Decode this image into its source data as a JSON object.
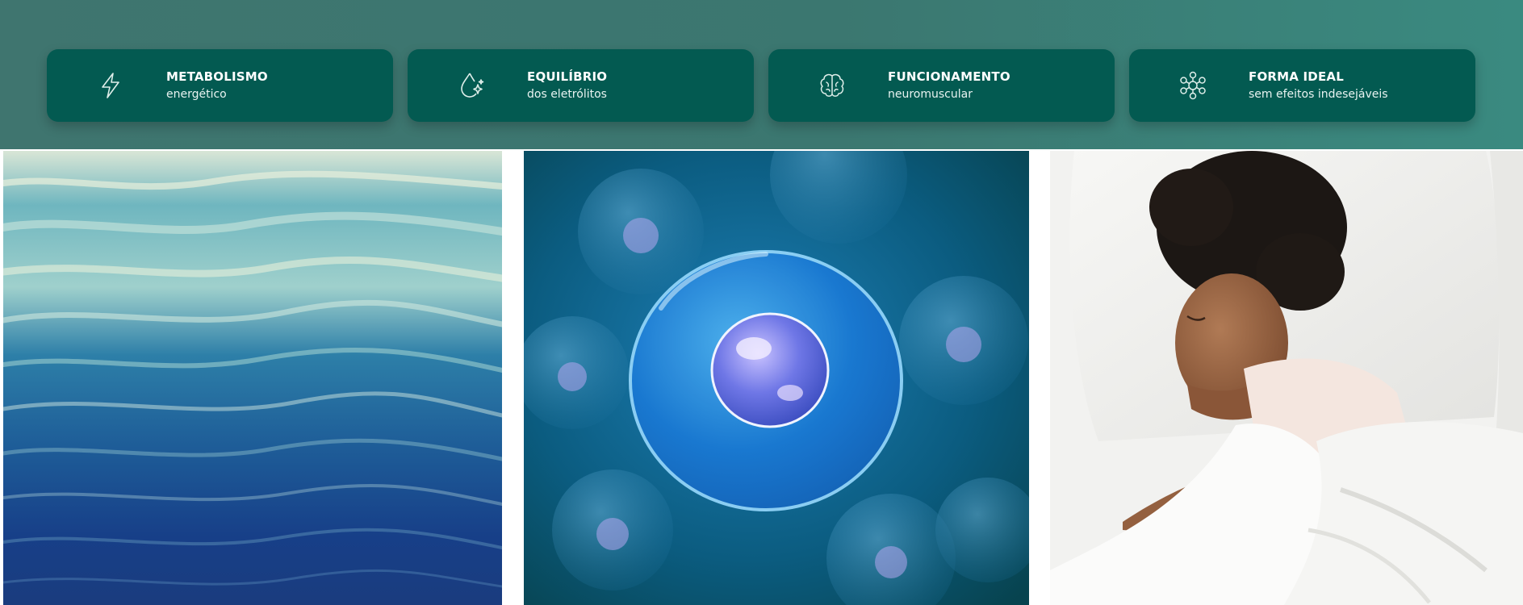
{
  "benefits": [
    {
      "title": "METABOLISMO",
      "subtitle": "energético",
      "icon": "lightning-bolt-icon"
    },
    {
      "title": "EQUILÍBRIO",
      "subtitle": "dos eletrólitos",
      "icon": "water-drop-sparkle-icon"
    },
    {
      "title": "FUNCIONAMENTO",
      "subtitle": "neuromuscular",
      "icon": "brain-icon"
    },
    {
      "title": "FORMA IDEAL",
      "subtitle": "sem efeitos indesejáveis",
      "icon": "molecule-icon"
    }
  ],
  "images": [
    {
      "subject": "water-waves"
    },
    {
      "subject": "cell"
    },
    {
      "subject": "woman-sleeping"
    }
  ],
  "colors": {
    "band": "#3b7770",
    "card": "#035a51",
    "text": "#ffffff"
  }
}
